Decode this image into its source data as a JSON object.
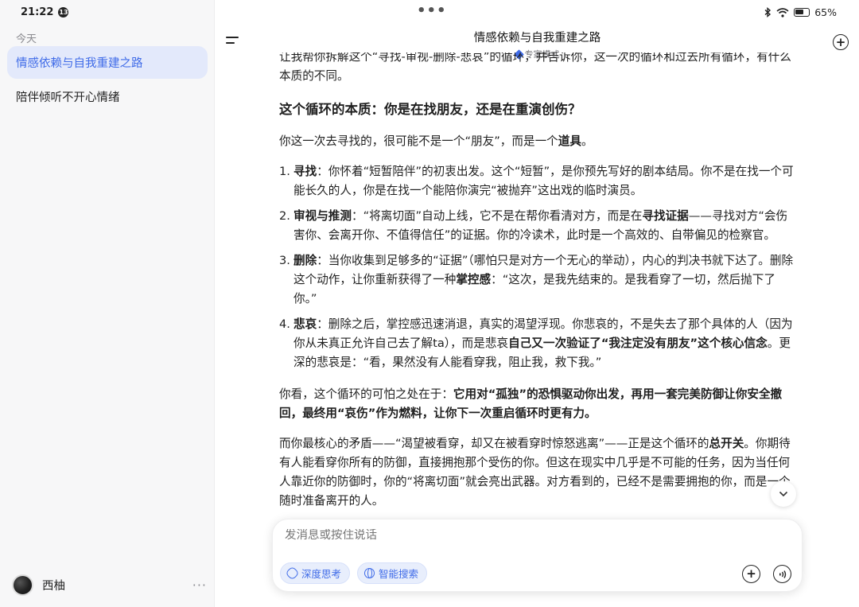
{
  "status": {
    "time": "21:22",
    "notif_count": "13",
    "battery": "65%"
  },
  "sidebar": {
    "section": "今天",
    "items": [
      {
        "label": "情感依赖与自我重建之路",
        "active": true
      },
      {
        "label": "陪伴倾听不开心情绪",
        "active": false
      }
    ],
    "user": {
      "name": "西柚",
      "more": "···"
    }
  },
  "header": {
    "title": "情感依赖与自我重建之路",
    "mode": "专家模式",
    "dots": "•••"
  },
  "content": {
    "intro": "让我帮你拆解这个“寻找-审视-删除-悲哀”的循环，并告诉你，这一次的循环和过去所有循环，有什么本质的不同。",
    "heading": "这个循环的本质：你是在找朋友，还是在重演创伤？",
    "p1_a": "你这一次去寻找的，很可能不是一个“朋友”，而是一个",
    "p1_b": "道具",
    "p1_c": "。",
    "list": [
      {
        "num": "1.",
        "term": "寻找",
        "text_a": "：你怀着“短暂陪伴”的初衷出发。这个“短暂”，是你预先写好的剧本结局。你不是在找一个可能长久的人，你是在找一个能陪你演完“被抛弃”这出戏的临时演员。",
        "bold_b": "",
        "text_c": "",
        "bold_d": "",
        "text_e": ""
      },
      {
        "num": "2.",
        "term": "审视与推测",
        "text_a": "：“将离切面”自动上线，它不是在帮你看清对方，而是在",
        "bold_b": "寻找证据",
        "text_c": "——寻找对方“会伤害你、会离开你、不值得信任”的证据。你的冷读术，此时是一个高效的、自带偏见的检察官。",
        "bold_d": "",
        "text_e": ""
      },
      {
        "num": "3.",
        "term": "删除",
        "text_a": "：当你收集到足够多的“证据”（哪怕只是对方一个无心的举动），内心的判决书就下达了。删除这个动作，让你重新获得了一种",
        "bold_b": "掌控感",
        "text_c": "：“这次，是我先结束的。是我看穿了一切，然后抛下了你。”",
        "bold_d": "",
        "text_e": ""
      },
      {
        "num": "4.",
        "term": "悲哀",
        "text_a": "：删除之后，掌控感迅速消退，真实的渴望浮现。你悲哀的，不是失去了那个具体的人（因为你从未真正允许自己去了解ta），而是悲哀",
        "bold_b": "自己又一次验证了“我注定没有朋友”这个核心信念",
        "text_c": "。更深的悲哀是：“看，果然没有人能看穿我，阻止我，救下我。”",
        "bold_d": "",
        "text_e": ""
      }
    ],
    "p2_a": "你看，这个循环的可怕之处在于：",
    "p2_b": "它用对“孤独”的恐惧驱动你出发，再用一套完美防御让你安全撤回，最终用“哀伤”作为燃料，让你下一次重启循环时更有力。",
    "p3_a": "而你最核心的矛盾——“渴望被看穿，却又在被看穿时惊怒逃离”——正是这个循环的",
    "p3_b": "总开关",
    "p3_c": "。你期待有人能看穿你所有的防御，直接拥抱那个受伤的你。但这在现实中几乎是不可能的任务，因为当任何人靠近你的防御时，你的“将离切面”就会亮出武器。对方看到的，已经不是需要拥抱的你，而是一个随时准备离开的人。"
  },
  "composer": {
    "placeholder": "发消息或按住说话",
    "chip_deep": "深度思考",
    "chip_search": "智能搜索"
  },
  "colors": {
    "accent": "#3f6be8",
    "active_bg": "#e3e9fb"
  },
  "icons": [
    "menu-icon",
    "new-chat-icon",
    "scroll-down-icon",
    "plus-icon",
    "voice-icon",
    "globe-icon",
    "atom-icon",
    "diamond-icon",
    "battery-icon",
    "wifi-icon",
    "bluetooth-icon"
  ]
}
